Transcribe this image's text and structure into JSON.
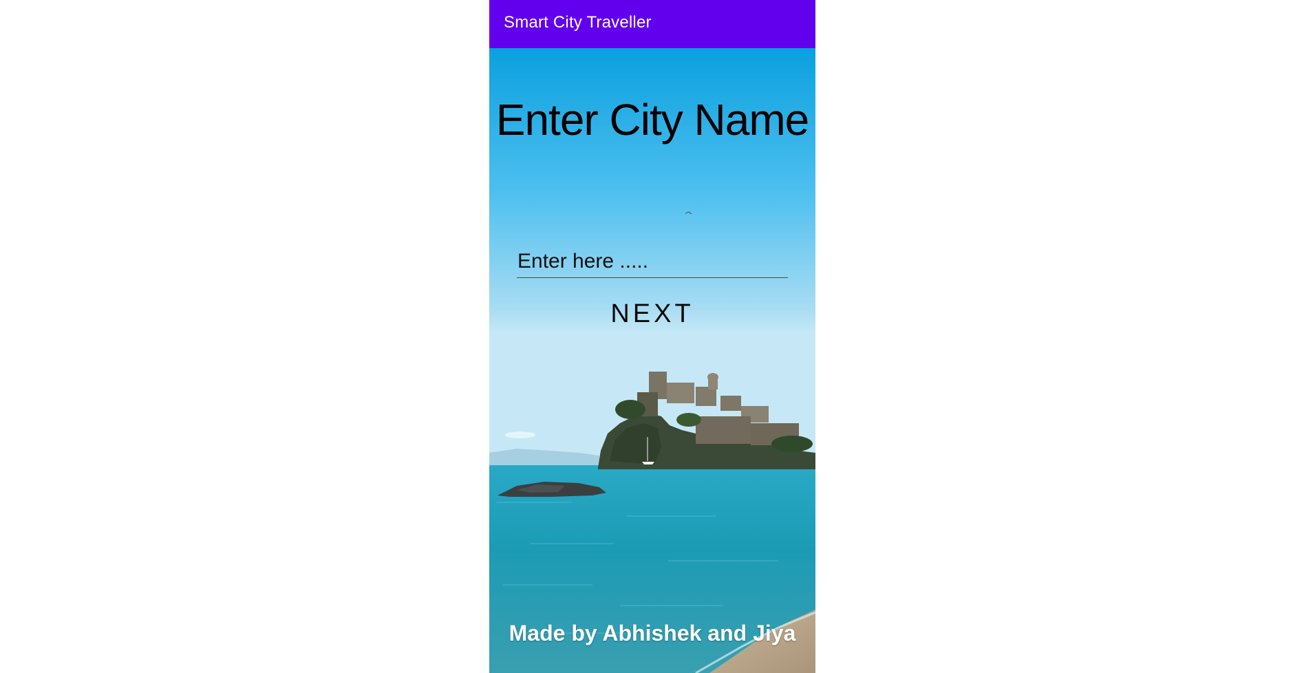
{
  "app": {
    "title": "Smart City Traveller",
    "bar_color": "#6200ee"
  },
  "main": {
    "heading": "Enter City Name",
    "city_input": {
      "value": "",
      "placeholder": "Enter here ....."
    },
    "next_label": "NEXT",
    "footer": "Made by Abhishek and Jiya"
  },
  "background": {
    "icon": "seaside-castle-island-photo",
    "sky_top": "#0aa0e0",
    "sky_bottom": "#b8e4f6",
    "sea": "#2aaec4"
  }
}
